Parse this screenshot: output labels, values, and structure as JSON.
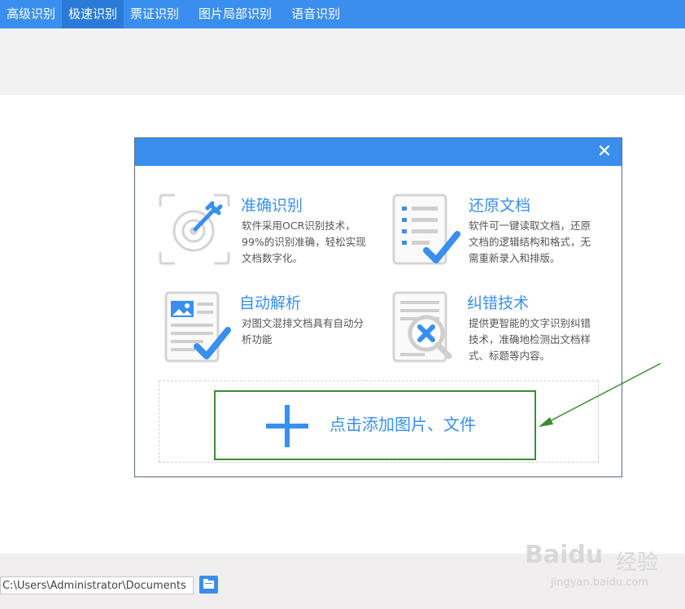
{
  "tabs": [
    {
      "label": "高级识别"
    },
    {
      "label": "极速识别",
      "active": true
    },
    {
      "label": "票证识别"
    },
    {
      "label": "图片局部识别"
    },
    {
      "label": "语音识别"
    }
  ],
  "dialog": {
    "close_glyph": "✕",
    "features": [
      {
        "title": "准确识别",
        "desc": "软件采用OCR识别技术，99%的识别准确，轻松实现文档数字化。",
        "icon": "target-icon"
      },
      {
        "title": "还原文档",
        "desc": "软件可一键读取文档，还原文档的逻辑结构和格式，无需重新录入和排版。",
        "icon": "document-check-icon"
      },
      {
        "title": "自动解析",
        "desc": "对图文混排文档具有自动分析功能",
        "icon": "image-document-icon"
      },
      {
        "title": "纠错技术",
        "desc": "提供更智能的文字识别纠错技术，准确地检测出文档样式、标题等内容。",
        "icon": "magnifier-x-icon"
      }
    ],
    "add_label": "点击添加图片、文件"
  },
  "footer": {
    "path_value": "C:\\Users\\Administrator\\Documents",
    "folder_icon": "folder-icon"
  },
  "watermark": {
    "logo": "Baidu",
    "cn": "经验",
    "url": "jingyan.baidu.com"
  },
  "colors": {
    "accent": "#3a8fee",
    "annotation": "#3c8c34"
  }
}
